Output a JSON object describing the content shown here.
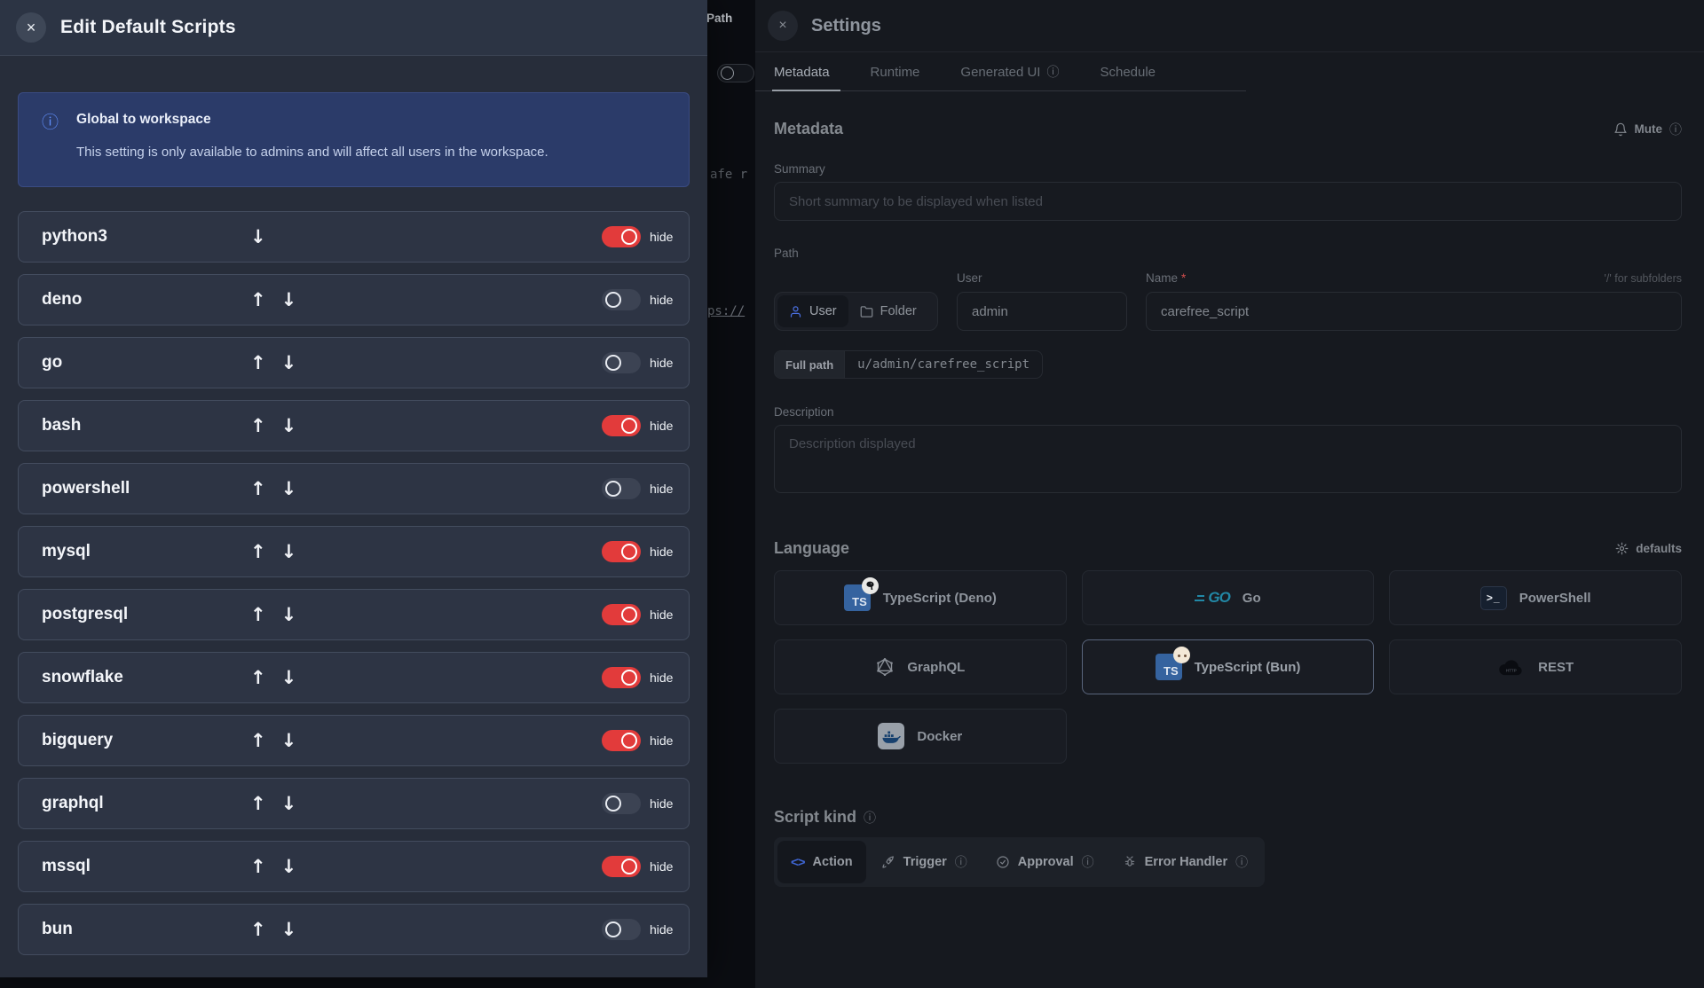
{
  "icons": {
    "close": "×",
    "info": "ⓘ",
    "up_arrow": "↑",
    "down_arrow": "↓"
  },
  "background": {
    "path_label": "Path",
    "code_fragment_top": "afe r",
    "code_fragment_bottom": "ps://"
  },
  "edit_scripts_panel": {
    "title": "Edit Default Scripts",
    "hide_label": "hide",
    "notice": {
      "title": "Global to workspace",
      "body": "This setting is only available to admins and will affect all users in the workspace."
    },
    "items": [
      {
        "name": "python3",
        "hidden": true,
        "can_move_up": false,
        "can_move_down": true
      },
      {
        "name": "deno",
        "hidden": false,
        "can_move_up": true,
        "can_move_down": true
      },
      {
        "name": "go",
        "hidden": false,
        "can_move_up": true,
        "can_move_down": true
      },
      {
        "name": "bash",
        "hidden": true,
        "can_move_up": true,
        "can_move_down": true
      },
      {
        "name": "powershell",
        "hidden": false,
        "can_move_up": true,
        "can_move_down": true
      },
      {
        "name": "mysql",
        "hidden": true,
        "can_move_up": true,
        "can_move_down": true
      },
      {
        "name": "postgresql",
        "hidden": true,
        "can_move_up": true,
        "can_move_down": true
      },
      {
        "name": "snowflake",
        "hidden": true,
        "can_move_up": true,
        "can_move_down": true
      },
      {
        "name": "bigquery",
        "hidden": true,
        "can_move_up": true,
        "can_move_down": true
      },
      {
        "name": "graphql",
        "hidden": false,
        "can_move_up": true,
        "can_move_down": true
      },
      {
        "name": "mssql",
        "hidden": true,
        "can_move_up": true,
        "can_move_down": true
      },
      {
        "name": "bun",
        "hidden": false,
        "can_move_up": true,
        "can_move_down": true
      }
    ]
  },
  "settings_panel": {
    "title": "Settings",
    "tabs": [
      {
        "label": "Metadata",
        "active": true
      },
      {
        "label": "Runtime",
        "active": false
      },
      {
        "label": "Generated UI",
        "active": false,
        "has_info": true
      },
      {
        "label": "Schedule",
        "active": false
      }
    ],
    "metadata": {
      "heading": "Metadata",
      "mute_label": "Mute",
      "summary_label": "Summary",
      "summary_placeholder": "Short summary to be displayed when listed",
      "path_label": "Path",
      "owner_toggle": {
        "user_label": "User",
        "folder_label": "Folder",
        "selected": "User"
      },
      "user_field": {
        "label": "User",
        "value": "admin"
      },
      "name_field": {
        "label": "Name",
        "required_mark": "*",
        "value": "carefree_script",
        "hint": "'/' for subfolders"
      },
      "full_path": {
        "label": "Full path",
        "value": "u/admin/carefree_script"
      },
      "description_label": "Description",
      "description_placeholder": "Description displayed"
    },
    "language": {
      "heading": "Language",
      "defaults_label": "defaults",
      "options": [
        {
          "label": "TypeScript (Deno)",
          "icon": "typescript-deno-icon",
          "selected": false
        },
        {
          "label": "Go",
          "icon": "go-icon",
          "selected": false
        },
        {
          "label": "PowerShell",
          "icon": "powershell-icon",
          "selected": false
        },
        {
          "label": "GraphQL",
          "icon": "graphql-icon",
          "selected": false
        },
        {
          "label": "TypeScript (Bun)",
          "icon": "typescript-bun-icon",
          "selected": true
        },
        {
          "label": "REST",
          "icon": "rest-icon",
          "selected": false
        },
        {
          "label": "Docker",
          "icon": "docker-icon",
          "selected": false
        }
      ]
    },
    "script_kind": {
      "heading": "Script kind",
      "options": [
        {
          "label": "Action",
          "icon": "code-icon",
          "selected": true,
          "has_info": false
        },
        {
          "label": "Trigger",
          "icon": "rocket-icon",
          "selected": false,
          "has_info": true
        },
        {
          "label": "Approval",
          "icon": "check-circle-icon",
          "selected": false,
          "has_info": true
        },
        {
          "label": "Error Handler",
          "icon": "bug-icon",
          "selected": false,
          "has_info": true
        }
      ]
    }
  },
  "colors": {
    "toggle_on": "#e23b3b",
    "toggle_off": "#3c4353",
    "notice_bg": "#2b3b69",
    "notice_info_blue": "#5e8cf7",
    "accent_blue": "#4a6fe0",
    "action_blue": "#3f66d4",
    "required_red": "#d14d4d",
    "left_panel_bg": "#272d3a",
    "card_bg": "#2d3444",
    "right_panel_bg": "#16191f",
    "ts_blue": "#35639f",
    "go_teal": "#2288a6",
    "docker_gray": "#99a0a9"
  }
}
